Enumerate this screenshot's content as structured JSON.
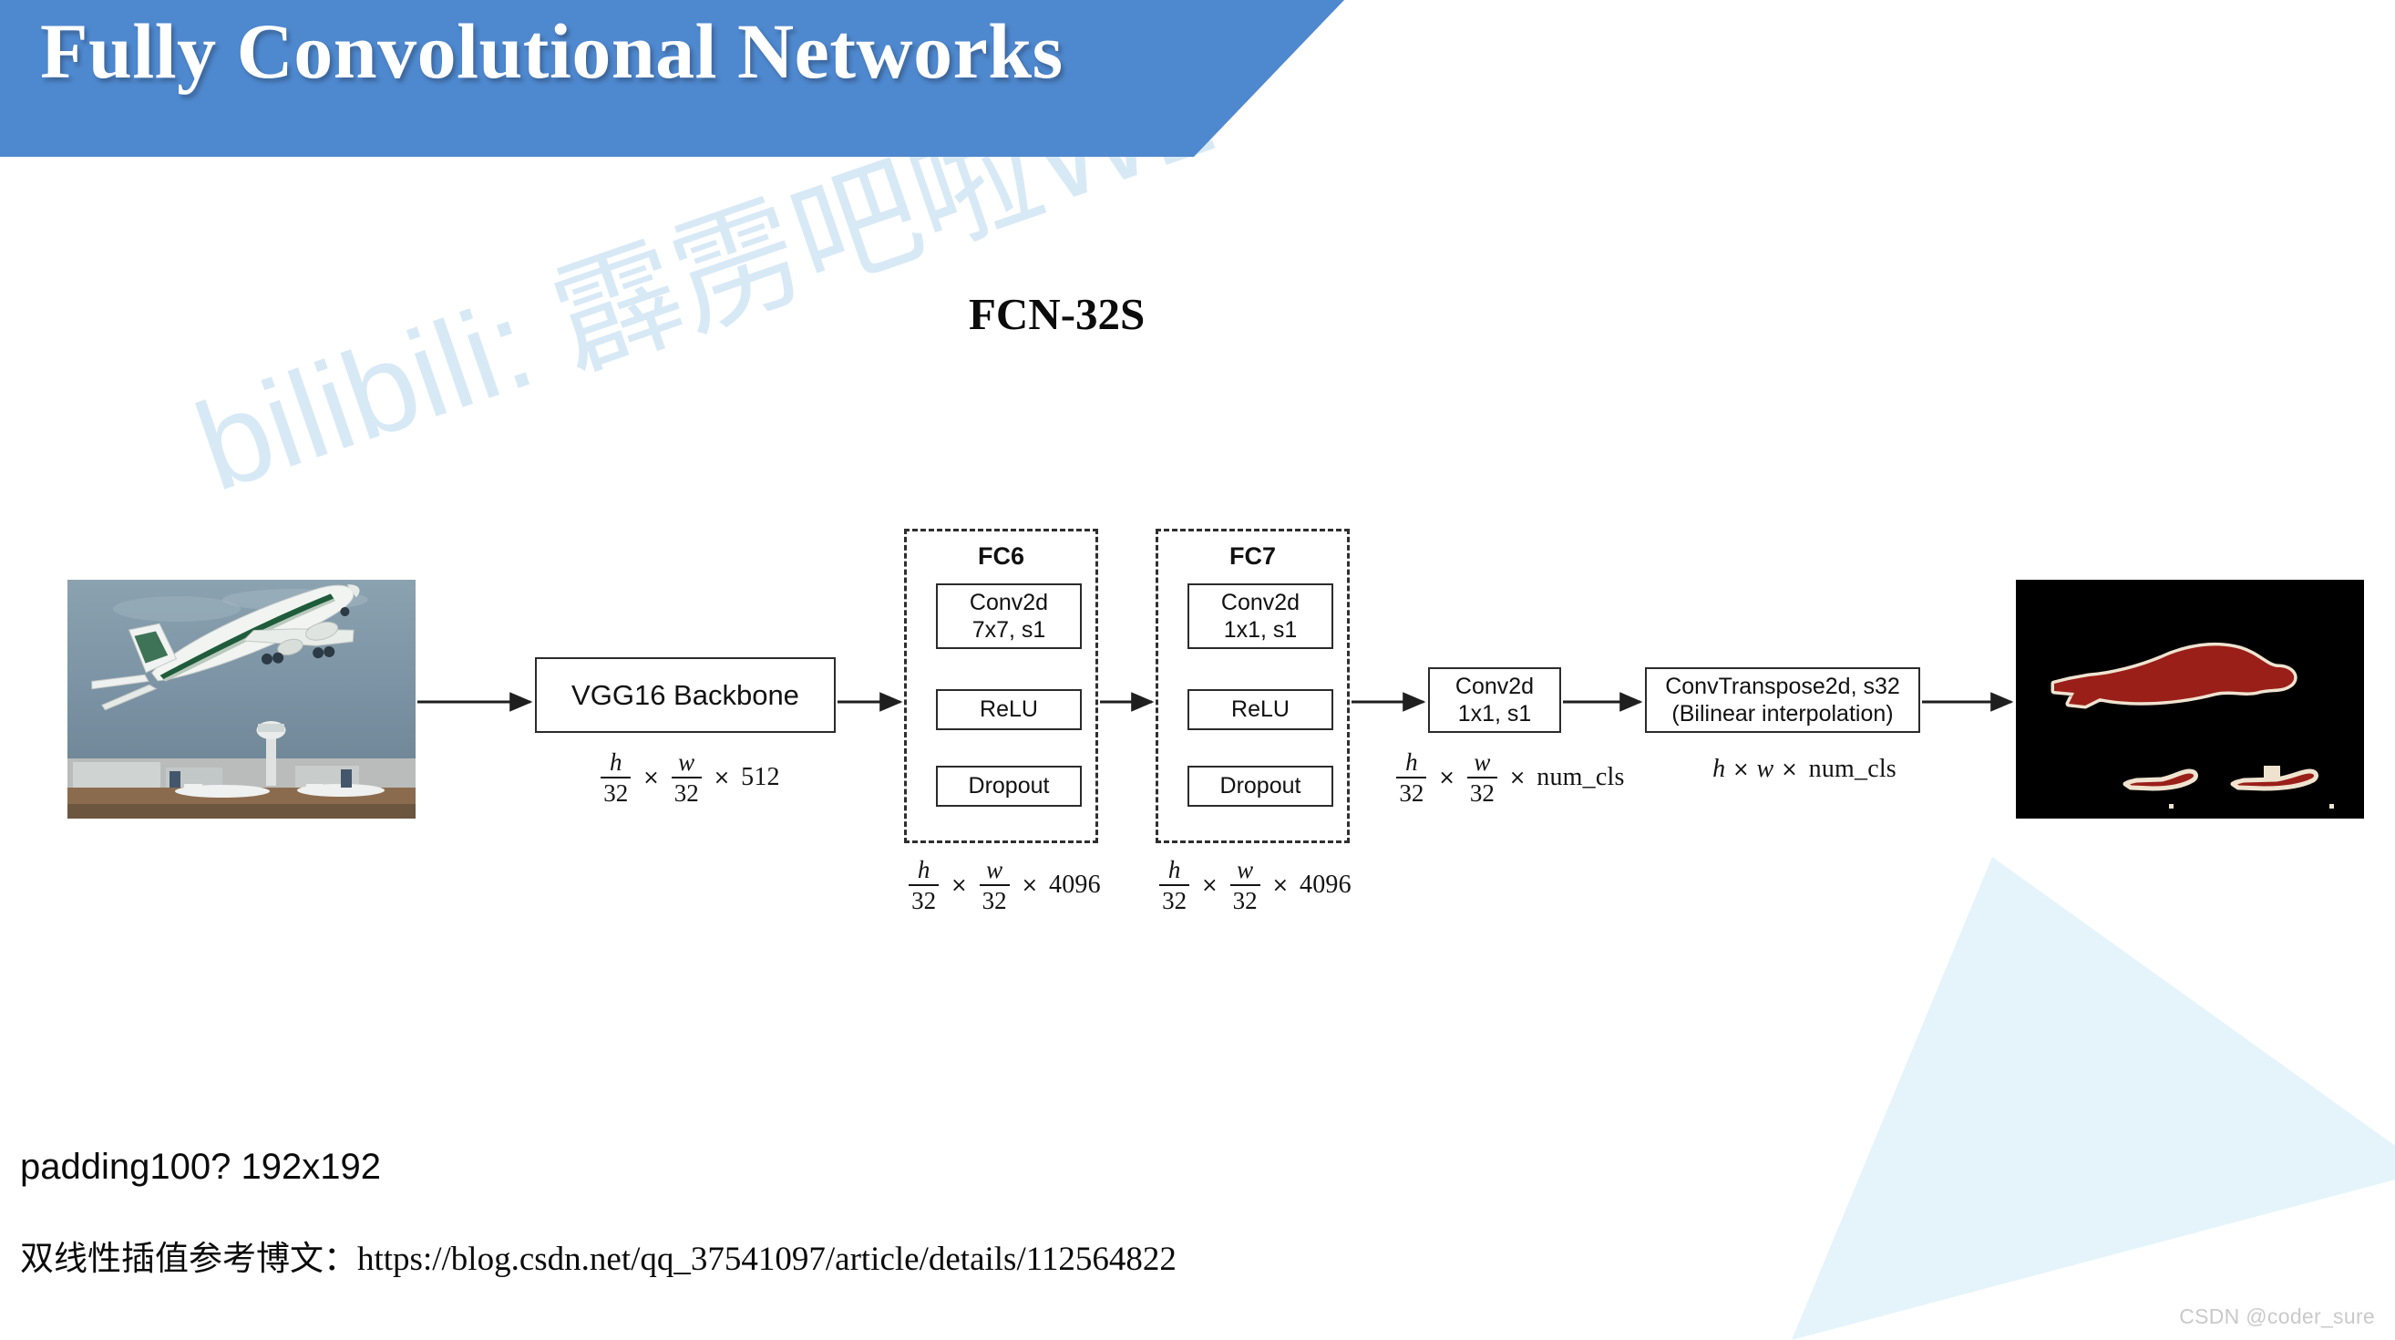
{
  "header": {
    "title": "Fully Convolutional Networks",
    "bg_color": "#4e88ce",
    "text_color": "#ffffff"
  },
  "section": {
    "title": "FCN-32S"
  },
  "watermark": {
    "text": "bilibili: 霹雳吧啦Wz",
    "color": "#d8e9f6"
  },
  "diagram": {
    "input_image": {
      "alt": "airplane taking off at airport",
      "caption": ""
    },
    "output_image": {
      "alt": "segmentation mask of airplanes",
      "caption": ""
    },
    "blocks": {
      "vgg": "VGG16 Backbone",
      "conv77_line1": "Conv2d",
      "conv77_line2": "7x7, s1",
      "relu6": "ReLU",
      "dropout6": "Dropout",
      "conv11_line1": "Conv2d",
      "conv11_line2": "1x1, s1",
      "relu7": "ReLU",
      "dropout7": "Dropout",
      "score_line1": "Conv2d",
      "score_line2": "1x1, s1",
      "upsample_line1": "ConvTranspose2d, s32",
      "upsample_line2": "(Bilinear interpolation)"
    },
    "groups": {
      "fc6": "FC6",
      "fc7": "FC7"
    },
    "shapes": {
      "vgg_num_h": "h",
      "vgg_den_h": "32",
      "vgg_num_w": "w",
      "vgg_den_w": "32",
      "vgg_channels": "512",
      "fc6_num_h": "h",
      "fc6_den_h": "32",
      "fc6_num_w": "w",
      "fc6_den_w": "32",
      "fc6_channels": "4096",
      "fc7_num_h": "h",
      "fc7_den_h": "32",
      "fc7_num_w": "w",
      "fc7_den_w": "32",
      "fc7_channels": "4096",
      "score_num_h": "h",
      "score_den_h": "32",
      "score_num_w": "w",
      "score_den_w": "32",
      "score_channels": "num_cls",
      "up_h": "h",
      "up_w": "w",
      "up_channels": "num_cls",
      "times_symbol": "×"
    }
  },
  "notes": {
    "padding": "padding100?   192x192",
    "reference": "双线性插值参考博文：https://blog.csdn.net/qq_37541097/article/details/112564822"
  },
  "footer": {
    "csdn": "CSDN @coder_sure"
  }
}
